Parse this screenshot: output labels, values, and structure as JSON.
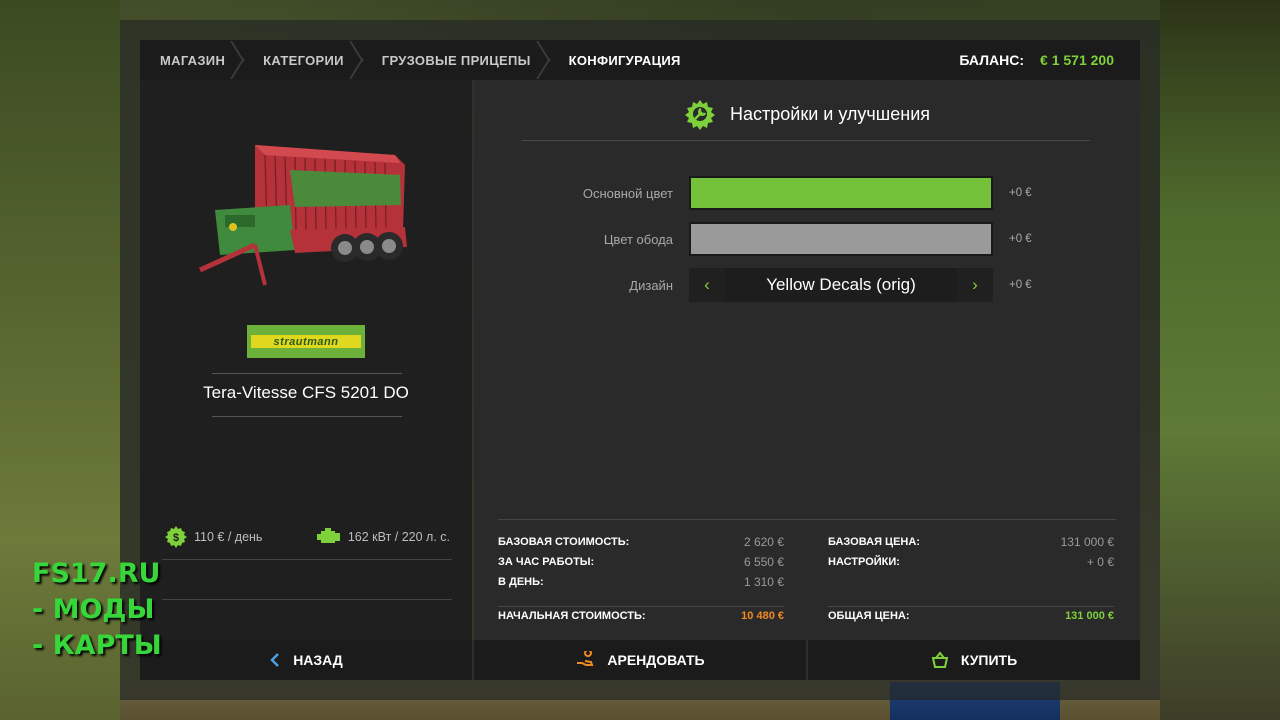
{
  "breadcrumbs": [
    "МАГАЗИН",
    "КАТЕГОРИИ",
    "ГРУЗОВЫЕ ПРИЦЕПЫ",
    "КОНФИГУРАЦИЯ"
  ],
  "balance": {
    "label": "БАЛАНС:",
    "value": "€ 1 571 200"
  },
  "vehicle": {
    "brand_logo_text": "strautmann",
    "name": "Tera-Vitesse CFS 5201 DO",
    "daily_cost": "110 € / день",
    "power": "162 кВт / 220 л. с."
  },
  "settings": {
    "title": "Настройки и улучшения",
    "options": [
      {
        "label": "Основной цвет",
        "price": "+0 €",
        "color": "#73c23a"
      },
      {
        "label": "Цвет обода",
        "price": "+0 €",
        "color": "#9a9a9a"
      },
      {
        "label": "Дизайн",
        "price": "+0 €",
        "value": "Yellow Decals (orig)"
      }
    ]
  },
  "costs": {
    "left": [
      {
        "key": "БАЗОВАЯ СТОИМОСТЬ:",
        "value": "2 620 €"
      },
      {
        "key": "ЗА ЧАС РАБОТЫ:",
        "value": "6 550 €"
      },
      {
        "key": "В ДЕНЬ:",
        "value": "1 310 €"
      }
    ],
    "right": [
      {
        "key": "БАЗОВАЯ ЦЕНА:",
        "value": "131 000 €"
      },
      {
        "key": "НАСТРОЙКИ:",
        "value": "+ 0 €"
      }
    ],
    "initial_total": {
      "key": "НАЧАЛЬНАЯ СТОИМОСТЬ:",
      "value": "10 480 €",
      "color": "#f08a24"
    },
    "grand_total": {
      "key": "ОБЩАЯ ЦЕНА:",
      "value": "131 000 €",
      "color": "#7fd13b"
    }
  },
  "actions": {
    "back": "НАЗАД",
    "lease": "АРЕНДОВАТЬ",
    "buy": "КУПИТЬ"
  },
  "watermark": [
    "FS17.RU",
    " - МОДЫ",
    " - КАРТЫ"
  ],
  "accent_color": "#7fd13b"
}
